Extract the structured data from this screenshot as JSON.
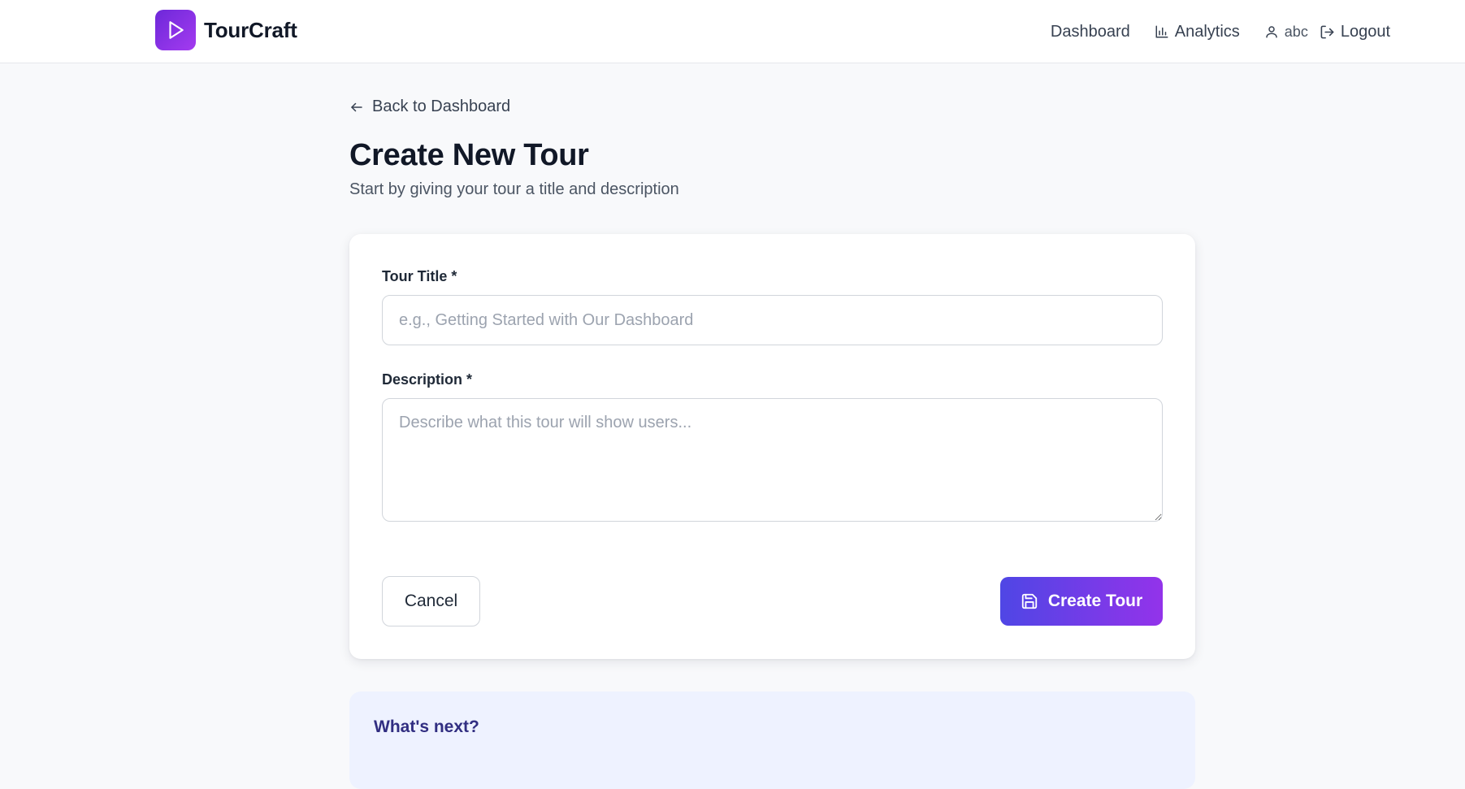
{
  "header": {
    "brand_name": "TourCraft",
    "logo_icon": "play-icon",
    "nav": {
      "dashboard": "Dashboard",
      "analytics": "Analytics",
      "username": "abc",
      "logout": "Logout"
    }
  },
  "page": {
    "back_label": "Back to Dashboard",
    "title": "Create New Tour",
    "subtitle": "Start by giving your tour a title and description"
  },
  "form": {
    "title_label": "Tour Title *",
    "title_value": "",
    "title_placeholder": "e.g., Getting Started with Our Dashboard",
    "description_label": "Description *",
    "description_value": "",
    "description_placeholder": "Describe what this tour will show users...",
    "cancel_label": "Cancel",
    "create_label": "Create Tour"
  },
  "next_section": {
    "title": "What's next?"
  },
  "colors": {
    "accent_start": "#4f46e5",
    "accent_end": "#9333ea",
    "background": "#f8f9fb",
    "next_section_bg": "#eef2ff"
  }
}
